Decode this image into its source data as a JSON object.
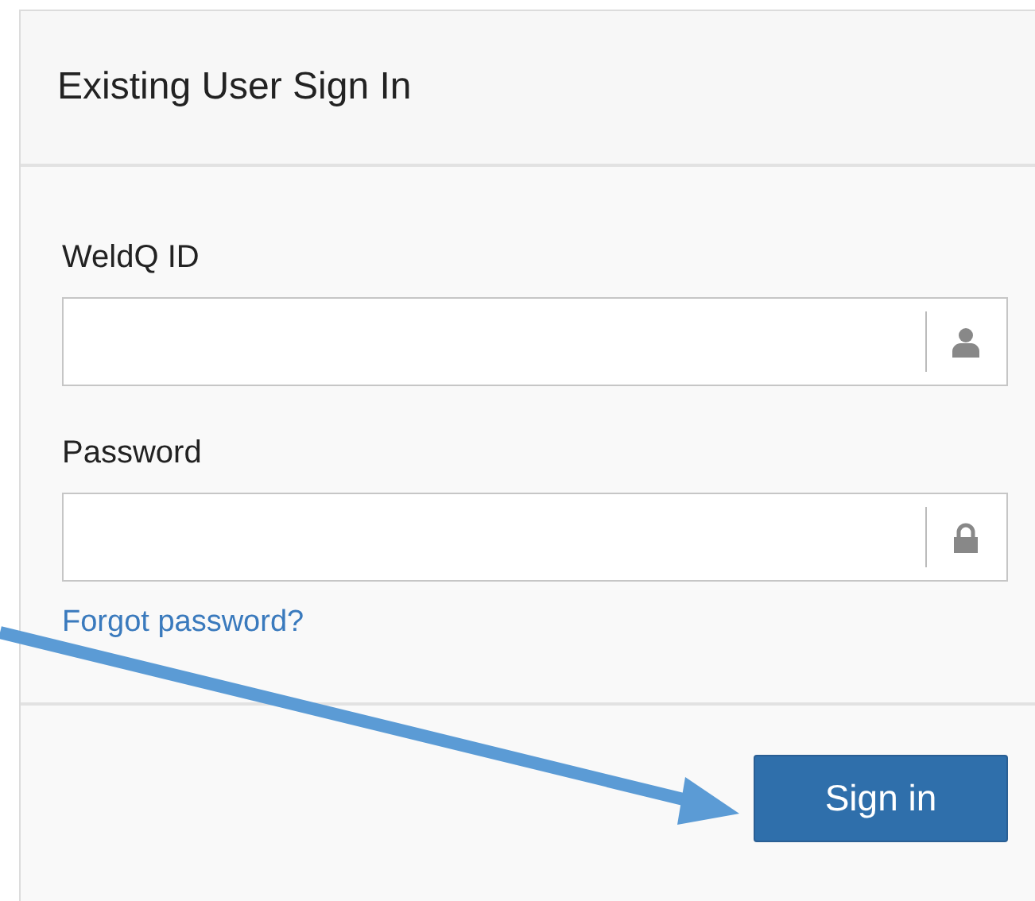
{
  "panel": {
    "title": "Existing User Sign In"
  },
  "fields": [
    {
      "label": "WeldQ ID",
      "kind": "user"
    },
    {
      "label": "Password",
      "kind": "password"
    }
  ],
  "forgot_link": "Forgot password?",
  "buttons": [
    {
      "label": "Sign in"
    }
  ]
}
